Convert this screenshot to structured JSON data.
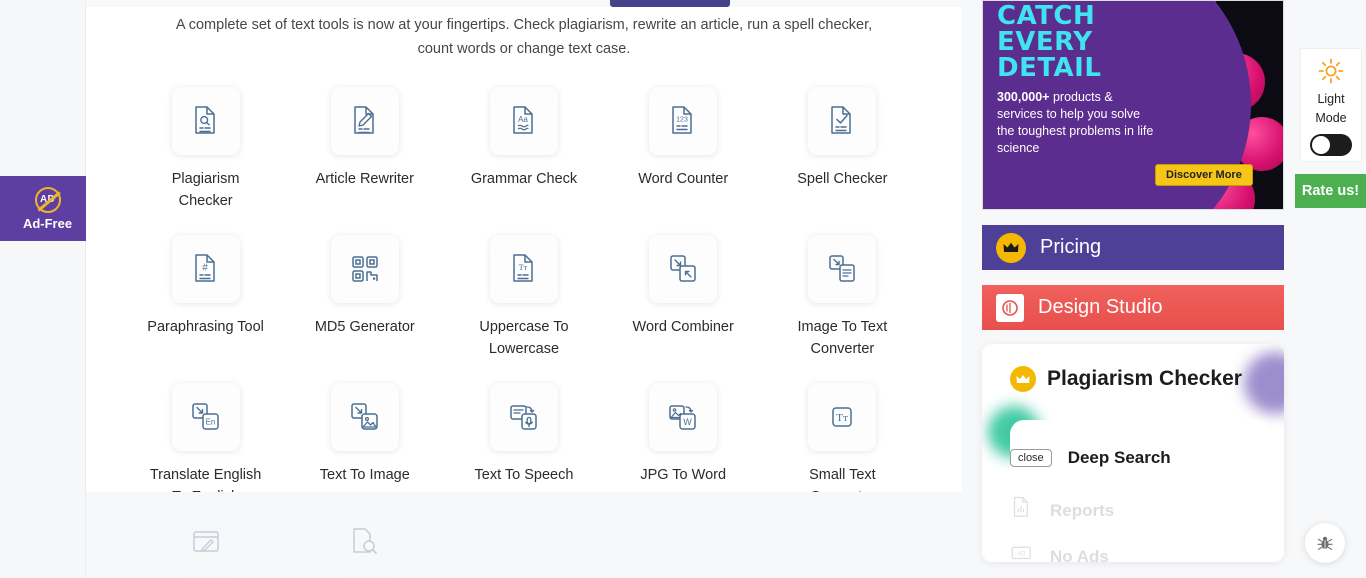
{
  "intro": {
    "line1": "A complete set of text tools is now at your fingertips. Check plagiarism, rewrite an article, run a spell checker,",
    "line2": "count words or change text case."
  },
  "tools": [
    {
      "label": "Plagiarism Checker",
      "icon": "document-search-icon"
    },
    {
      "label": "Article Rewriter",
      "icon": "document-pencil-icon"
    },
    {
      "label": "Grammar Check",
      "icon": "document-aa-icon"
    },
    {
      "label": "Word Counter",
      "icon": "document-123-icon"
    },
    {
      "label": "Spell Checker",
      "icon": "document-check-icon"
    },
    {
      "label": "Paraphrasing Tool",
      "icon": "document-hash-icon"
    },
    {
      "label": "MD5 Generator",
      "icon": "qr-code-icon"
    },
    {
      "label": "Uppercase To Lowercase",
      "icon": "document-tt-icon"
    },
    {
      "label": "Word Combiner",
      "icon": "two-pages-arrows-icon"
    },
    {
      "label": "Image To Text Converter",
      "icon": "image-to-text-icon"
    },
    {
      "label": "Translate English To English",
      "icon": "translate-en-icon"
    },
    {
      "label": "Text To Image",
      "icon": "text-to-image-icon"
    },
    {
      "label": "Text To Speech",
      "icon": "text-to-speech-icon"
    },
    {
      "label": "JPG To Word",
      "icon": "jpg-to-word-icon"
    },
    {
      "label": "Small Text Generator",
      "icon": "small-text-tt-icon"
    }
  ],
  "faded_tools": [
    {
      "icon": "browser-pencil-icon"
    },
    {
      "icon": "document-magnifier-icon"
    }
  ],
  "ad": {
    "headline_line1": "CATCH",
    "headline_line2": "EVERY",
    "headline_line3": "DETAIL",
    "body_strong": "300,000+",
    "body_rest": " products & services to help you solve the toughest problems in life science",
    "cta_label": "Discover More",
    "headline_color": "#3fe4f0",
    "panel_color": "#5b2d8e",
    "cta_color": "#f5c518"
  },
  "sidebar_buttons": {
    "pricing": {
      "label": "Pricing",
      "icon": "crown-icon",
      "color": "#4e3f97"
    },
    "design_studio": {
      "label": "Design Studio",
      "icon": "design-studio-logo-icon",
      "color": "#e8504c"
    }
  },
  "plagiarism_card": {
    "title": "Plagiarism Checker",
    "crown_icon": "crown-icon",
    "close_label": "close",
    "feature_label": "Deep Search",
    "dimmed_items": [
      {
        "label": "Reports",
        "icon": "report-document-icon"
      },
      {
        "label": "No Ads",
        "icon": "no-ads-icon"
      }
    ]
  },
  "controls": {
    "mode_line1": "Light",
    "mode_line2": "Mode",
    "mode_icon": "sun-icon",
    "toggle_state": "off",
    "rate_label": "Rate us!",
    "rate_color": "#4caf50",
    "bug_icon": "bug-icon"
  },
  "adfree": {
    "label": "Ad-Free",
    "icon": "no-ad-circle-icon",
    "badge_text": "AD",
    "color": "#5c3fa0"
  }
}
